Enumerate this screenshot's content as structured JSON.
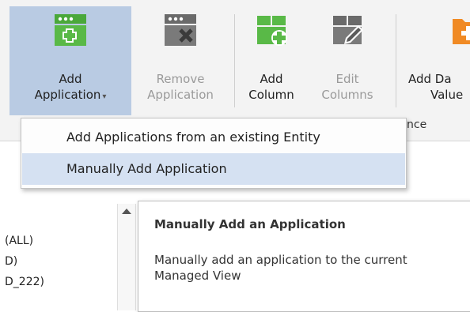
{
  "ribbon": {
    "add_application": {
      "line1": "Add",
      "line2": "Application",
      "caret": "▾",
      "icon": "add-window-icon"
    },
    "remove_application": {
      "line1": "Remove",
      "line2": "Application",
      "icon": "remove-window-icon"
    },
    "add_column": {
      "line1": "Add",
      "line2": "Column",
      "icon": "add-column-icon"
    },
    "edit_columns": {
      "line1": "Edit",
      "line2": "Columns",
      "icon": "edit-columns-icon"
    },
    "add_data_value": {
      "line1": "Add Da",
      "line2": "Value",
      "icon": "add-folder-icon"
    },
    "group_label_fragment": "nce"
  },
  "menu": {
    "items": [
      {
        "label": "Add Applications from an existing Entity"
      },
      {
        "label": "Manually Add Application"
      }
    ]
  },
  "list": {
    "items": [
      "(ALL)",
      "D)",
      "D_222)"
    ]
  },
  "tooltip": {
    "title": "Manually Add an Application",
    "body": "Manually add an application to the current Managed View"
  },
  "colors": {
    "green": "#59b947",
    "gray_icon": "#707070",
    "orange": "#f08a24",
    "selection": "#b9cbe3",
    "menu_highlight": "#d5e1f2"
  }
}
